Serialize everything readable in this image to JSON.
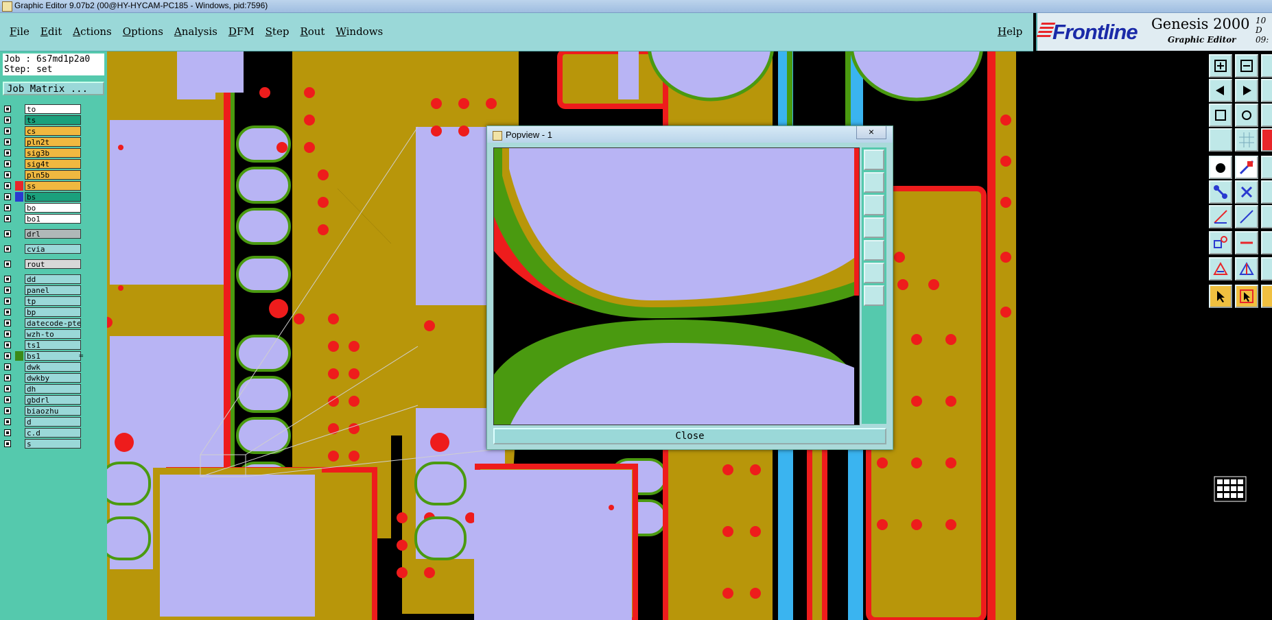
{
  "window": {
    "title": "Graphic Editor 9.07b2 (00@HY-HYCAM-PC185 - Windows, pid:7596)"
  },
  "menu": {
    "items": [
      "File",
      "Edit",
      "Actions",
      "Options",
      "Analysis",
      "DFM",
      "Step",
      "Rout",
      "Windows"
    ],
    "help": "Help"
  },
  "brand": {
    "logo": "Frontline",
    "product": "Genesis 2000",
    "subtitle": "Graphic Editor",
    "date_top": "10 D",
    "date_bottom": "09:"
  },
  "job": {
    "job_line": "Job : 6s7md1p2a0",
    "step_line": "Step: set",
    "matrix_button": "Job Matrix ..."
  },
  "layers": [
    {
      "name": "to",
      "bg": "#ffffff",
      "sw": ""
    },
    {
      "name": "ts",
      "bg": "#1aa07c",
      "sw": ""
    },
    {
      "name": "cs",
      "bg": "#f0b840",
      "sw": ""
    },
    {
      "name": "pln2t",
      "bg": "#f0b840",
      "sw": ""
    },
    {
      "name": "sig3b",
      "bg": "#f0b840",
      "sw": ""
    },
    {
      "name": "sig4t",
      "bg": "#f0b840",
      "sw": ""
    },
    {
      "name": "pln5b",
      "bg": "#f0b840",
      "sw": ""
    },
    {
      "name": "ss",
      "bg": "#f0b840",
      "sw": "#e8262a"
    },
    {
      "name": "bs",
      "bg": "#1aa07c",
      "sw": "#2a3ad0"
    },
    {
      "name": "bo",
      "bg": "#ffffff",
      "sw": ""
    },
    {
      "name": "bo1",
      "bg": "#ffffff",
      "sw": ""
    },
    {
      "name": "drl",
      "bg": "#b0b8b8",
      "sw": "",
      "gap": true
    },
    {
      "name": "cvia",
      "bg": "#9ad8d8",
      "sw": "",
      "gap": true
    },
    {
      "name": "rout",
      "bg": "#d8d8d8",
      "sw": "",
      "gap": true
    },
    {
      "name": "dd",
      "bg": "#9ad8d8",
      "sw": "",
      "gap": true
    },
    {
      "name": "panel",
      "bg": "#9ad8d8",
      "sw": ""
    },
    {
      "name": "tp",
      "bg": "#9ad8d8",
      "sw": ""
    },
    {
      "name": "bp",
      "bg": "#9ad8d8",
      "sw": ""
    },
    {
      "name": "datecode-pte",
      "bg": "#9ad8d8",
      "sw": ""
    },
    {
      "name": "wzh-to",
      "bg": "#9ad8d8",
      "sw": ""
    },
    {
      "name": "ts1",
      "bg": "#9ad8d8",
      "sw": ""
    },
    {
      "name": "bs1",
      "bg": "#9ad8d8",
      "sw": "#3a8a18",
      "mark": "="
    },
    {
      "name": "dwk",
      "bg": "#9ad8d8",
      "sw": ""
    },
    {
      "name": "dwkby",
      "bg": "#9ad8d8",
      "sw": ""
    },
    {
      "name": "dh",
      "bg": "#9ad8d8",
      "sw": ""
    },
    {
      "name": "gbdrl",
      "bg": "#9ad8d8",
      "sw": ""
    },
    {
      "name": "biaozhu",
      "bg": "#9ad8d8",
      "sw": ""
    },
    {
      "name": "d",
      "bg": "#9ad8d8",
      "sw": ""
    },
    {
      "name": "c.d",
      "bg": "#9ad8d8",
      "sw": ""
    },
    {
      "name": "s",
      "bg": "#9ad8d8",
      "sw": ""
    }
  ],
  "popview": {
    "title": "Popview - 1",
    "close_x": "×",
    "close_button": "Close"
  },
  "colors": {
    "copper": "#b8960a",
    "pad": "#b8b4f4",
    "mask": "#4a9a10",
    "red": "#ee1c1c",
    "blue": "#3ab4f0",
    "panel": "#55c9ad"
  }
}
